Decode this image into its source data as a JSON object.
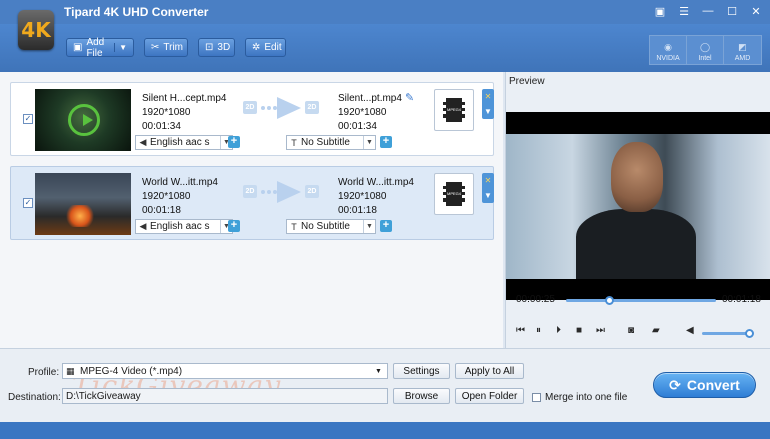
{
  "window": {
    "title": "Tipard 4K UHD Converter",
    "controls": [
      "▣",
      "☰",
      "—",
      "☐",
      "✕"
    ]
  },
  "toolbar": {
    "logo_text": "4K",
    "add_file": "Add File",
    "trim": "Trim",
    "three_d": "3D",
    "edit": "Edit",
    "accel": [
      "NVIDIA",
      "Intel",
      "AMD"
    ]
  },
  "files": [
    {
      "src_name": "Silent H...cept.mp4",
      "src_res": "1920*1080",
      "src_dur": "00:01:34",
      "dst_name": "Silent...pt.mp4",
      "dst_res": "1920*1080",
      "dst_dur": "00:01:34",
      "audio": "English aac s",
      "subtitle": "No Subtitle",
      "badge": "2D",
      "format_icon": "MPEG4"
    },
    {
      "src_name": "World W...itt.mp4",
      "src_res": "1920*1080",
      "src_dur": "00:01:18",
      "dst_name": "World W...itt.mp4",
      "dst_res": "1920*1080",
      "dst_dur": "00:01:18",
      "audio": "English aac s",
      "subtitle": "No Subtitle",
      "badge": "2D",
      "format_icon": "MPEG4"
    }
  ],
  "preview": {
    "label": "Preview",
    "current_time": "00:00:25",
    "total_time": "00:01:18",
    "progress": 0.29,
    "volume": 0.95
  },
  "bottom": {
    "profile_label": "Profile:",
    "profile_value": "MPEG-4 Video (*.mp4)",
    "settings": "Settings",
    "apply_all": "Apply to All",
    "destination_label": "Destination:",
    "destination_value": "D:\\TickGiveaway",
    "browse": "Browse",
    "open_folder": "Open Folder",
    "merge": "Merge into one file",
    "convert": "Convert",
    "watermark": "TickGiveaway"
  }
}
